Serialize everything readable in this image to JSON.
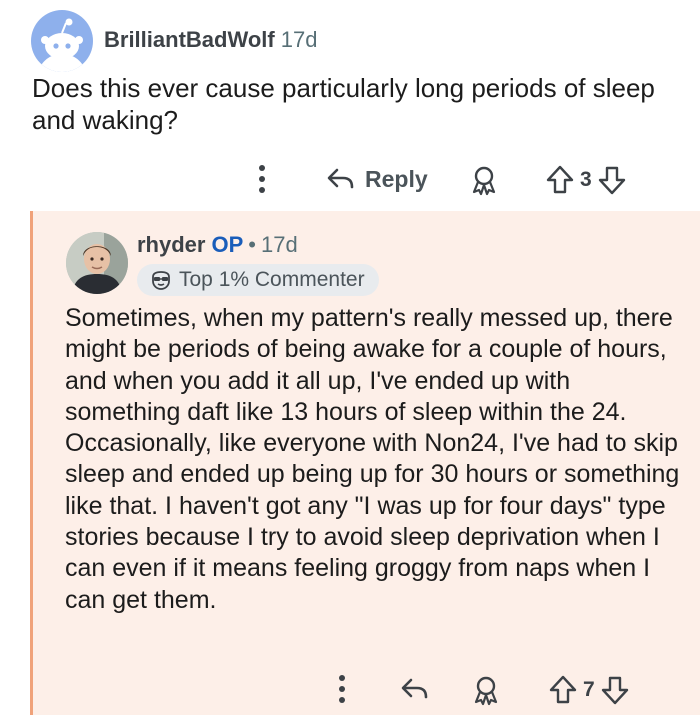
{
  "comment": {
    "username": "BrilliantBadWolf",
    "age": "17d",
    "body": "Does this ever cause particularly long periods of sleep and waking?",
    "actions": {
      "more_icon": "vertical-ellipsis-icon",
      "reply_icon": "reply-arrow-icon",
      "reply_label": "Reply",
      "award_icon": "award-icon",
      "upvote_icon": "upvote-arrow-icon",
      "vote_count": "3",
      "downvote_icon": "downvote-arrow-icon"
    }
  },
  "reply": {
    "username": "rhyder",
    "op_badge": "OP",
    "separator": "•",
    "age": "17d",
    "flair_icon": "commenter-badge-icon",
    "flair": "Top 1% Commenter",
    "body": "Sometimes, when my pattern's really messed up, there might be periods of being awake for a couple of hours, and when you add it all up, I've ended up with something daft like 13 hours of sleep within the 24. Occasionally, like everyone with Non24, I've had to skip sleep and ended up being up for 30 hours or something like that. I haven't got any \"I was up for four days\" type stories because I try to avoid sleep deprivation when I can even if it means feeling groggy from naps when I can get them.",
    "actions": {
      "more_icon": "vertical-ellipsis-icon",
      "reply_icon": "reply-arrow-icon",
      "award_icon": "award-icon",
      "upvote_icon": "upvote-arrow-icon",
      "vote_count": "7",
      "downvote_icon": "downvote-arrow-icon"
    }
  },
  "colors": {
    "reply_background": "#fdefe8",
    "thread_line": "#f0a27a",
    "op_badge": "#1a5dba",
    "avatar_background": "#8eb0ec"
  }
}
